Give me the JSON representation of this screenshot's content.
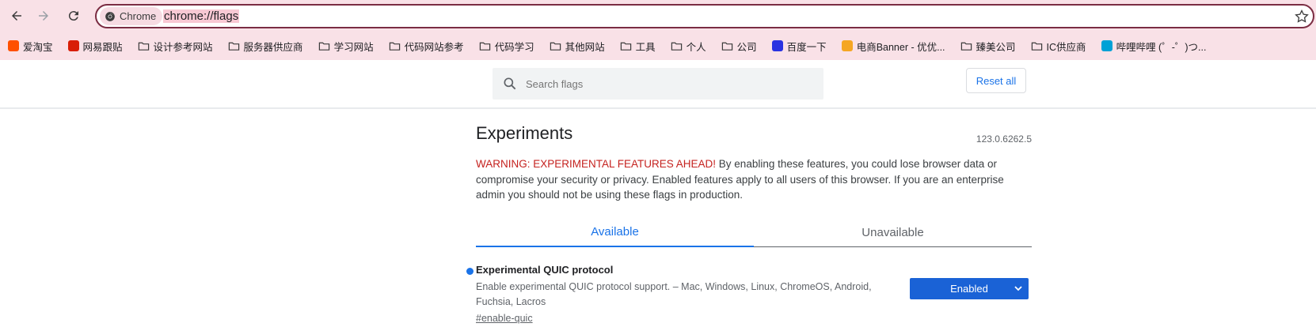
{
  "browser": {
    "chip_label": "Chrome",
    "url": "chrome://flags",
    "icons": [
      "back-icon",
      "forward-icon",
      "reload-icon",
      "chrome-logo-icon",
      "star-icon"
    ]
  },
  "bookmarks": [
    {
      "label": "爱淘宝",
      "icon": "taobao-icon",
      "color": "#ff5000"
    },
    {
      "label": "网易跟贴",
      "icon": "netease-icon",
      "color": "#d81e06"
    },
    {
      "label": "设计参考网站",
      "icon": "folder-icon"
    },
    {
      "label": "服务器供应商",
      "icon": "folder-icon"
    },
    {
      "label": "学习网站",
      "icon": "folder-icon"
    },
    {
      "label": "代码网站参考",
      "icon": "folder-icon"
    },
    {
      "label": "代码学习",
      "icon": "folder-icon"
    },
    {
      "label": "其他网站",
      "icon": "folder-icon"
    },
    {
      "label": "工具",
      "icon": "folder-icon"
    },
    {
      "label": "个人",
      "icon": "folder-icon"
    },
    {
      "label": "公司",
      "icon": "folder-icon"
    },
    {
      "label": "百度一下",
      "icon": "baidu-icon",
      "color": "#2932e1"
    },
    {
      "label": "电商Banner - 优优...",
      "icon": "tiger-icon",
      "color": "#f5a623"
    },
    {
      "label": "臻美公司",
      "icon": "folder-icon"
    },
    {
      "label": "IC供应商",
      "icon": "folder-icon"
    },
    {
      "label": "哔哩哔哩 (゜-゜)つ...",
      "icon": "bilibili-icon",
      "color": "#00a1d6"
    }
  ],
  "header": {
    "search_placeholder": "Search flags",
    "reset_label": "Reset all"
  },
  "main": {
    "title": "Experiments",
    "version": "123.0.6262.5",
    "warning_label": "WARNING: EXPERIMENTAL FEATURES AHEAD!",
    "warning_text": " By enabling these features, you could lose browser data or compromise your security or privacy. Enabled features apply to all users of this browser. If you are an enterprise admin you should not be using these flags in production.",
    "tabs": [
      {
        "label": "Available",
        "active": true
      },
      {
        "label": "Unavailable",
        "active": false
      }
    ],
    "flag": {
      "name": "Experimental QUIC protocol",
      "description": "Enable experimental QUIC protocol support. – Mac, Windows, Linux, ChromeOS, Android, Fuchsia, Lacros",
      "link": "#enable-quic",
      "state": "Enabled"
    }
  },
  "colors": {
    "accent": "#1a73e8",
    "warning": "#c5221f",
    "toolbar_bg": "#f9e1e7",
    "omnibox_border": "#7b2d43"
  }
}
